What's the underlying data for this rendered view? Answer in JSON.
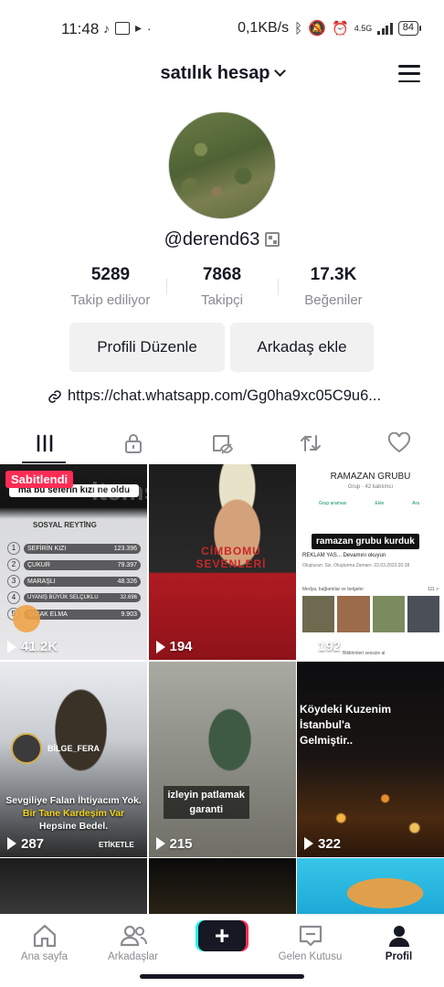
{
  "status_bar": {
    "time": "11:48",
    "net_speed": "0,1KB/s",
    "network": "4.5G",
    "battery": "84"
  },
  "header": {
    "account_name": "satılık hesap"
  },
  "profile": {
    "username": "@derend63",
    "stats": [
      {
        "value": "5289",
        "label": "Takip ediliyor"
      },
      {
        "value": "7868",
        "label": "Takipçi"
      },
      {
        "value": "17.3K",
        "label": "Beğeniler"
      }
    ],
    "edit_button": "Profili Düzenle",
    "add_friend_button": "Arkadaş ekle",
    "link": "https://chat.whatsapp.com/Gg0ha9xc05C9u6..."
  },
  "tabs": [
    "videos",
    "private",
    "reposts-hidden",
    "reposts",
    "liked"
  ],
  "videos": [
    {
      "views": "41.2K",
      "pinned": "Sabitlendi",
      "caption": "ma bu seferin kızı ne oldu",
      "watermark": "itemsatis",
      "inner_title": "SOSYAL REYTİNG",
      "rows": [
        {
          "rank": "1",
          "name": "SEFİRİN KIZI",
          "val": "123.396"
        },
        {
          "rank": "2",
          "name": "ÇUKUR",
          "val": "79.397"
        },
        {
          "rank": "3",
          "name": "MARAŞLI",
          "val": "48.326"
        },
        {
          "rank": "4",
          "name": "UYANIŞ BÜYÜK SELÇUKLU",
          "val": "32.696"
        },
        {
          "rank": "5",
          "name": "YASAK ELMA",
          "val": "9.903"
        }
      ]
    },
    {
      "views": "194",
      "caption": "CİMBOMU SEVENLERİ"
    },
    {
      "views": "192",
      "title": "RAMAZAN GRUBU",
      "subtitle": "Grup · 42 katılımcı",
      "caption": "ramazan grubu kurduk",
      "actions": [
        "Grup araması",
        "Ekle",
        "Ara"
      ],
      "line1": "REKLAM YAS... Devamını okuyun",
      "line2": "Oluşturan: Siz, Oluşturma Zamanı: 22.03.2023 20:38",
      "media": "Medya, bağlantılar ve belgeler",
      "media_count": "111 >",
      "footer": "Bildirimleri sessize al"
    },
    {
      "views": "287",
      "badge": "BİLGE_FERA",
      "line1": "Sevgiliye Falan İhtiyacım Yok.",
      "line2": "Bir Tane Kardeşim Var",
      "line3": "Hepsine Bedel.",
      "tag": "ETİKETLE"
    },
    {
      "views": "215",
      "caption_line1": "izleyin patlamak",
      "caption_line2": "garanti"
    },
    {
      "views": "322",
      "caption_line1": "Köydeki Kuzenim İstanbul'a",
      "caption_line2": "Gelmiştir.."
    },
    {
      "views": ""
    },
    {
      "views": ""
    },
    {
      "views": ""
    }
  ],
  "bottom_nav": {
    "home": "Ana sayfa",
    "friends": "Arkadaşlar",
    "plus": "+",
    "inbox": "Gelen Kutusu",
    "profile": "Profil"
  }
}
